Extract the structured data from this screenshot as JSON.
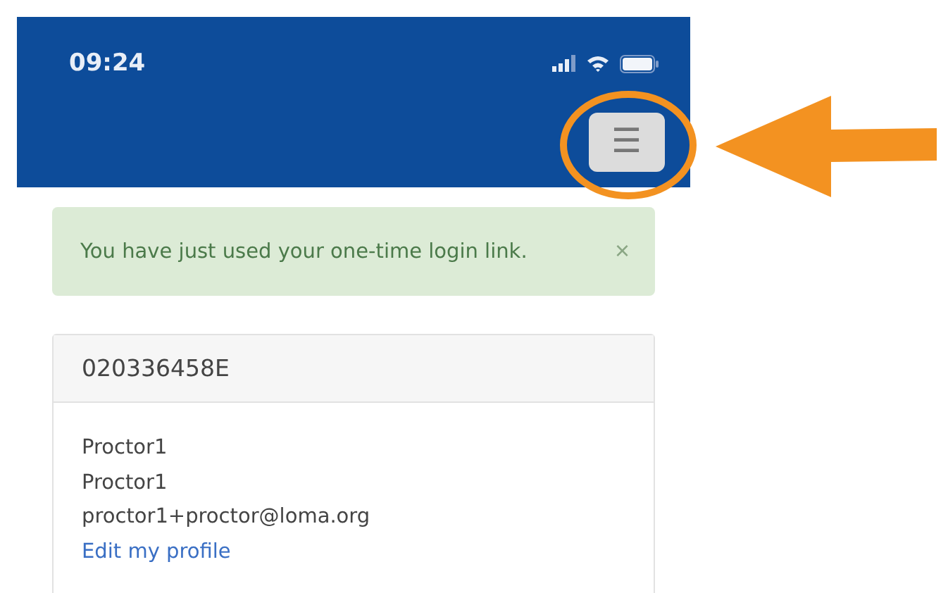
{
  "status_bar": {
    "time": "09:24"
  },
  "header": {
    "menu_button": {
      "label": "☰"
    }
  },
  "alert": {
    "message": "You have just used your one-time login link.",
    "close": "×"
  },
  "profile_card": {
    "title": "020336458E",
    "lines": [
      "Proctor1",
      "Proctor1",
      "proctor1+proctor@loma.org"
    ],
    "link": "Edit my profile"
  }
}
